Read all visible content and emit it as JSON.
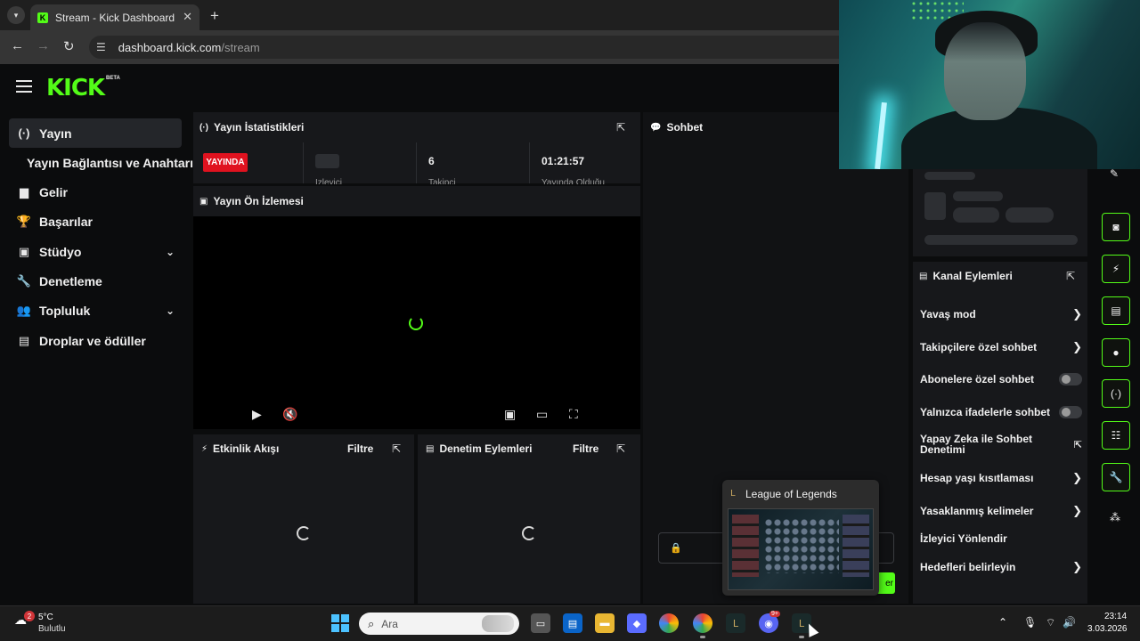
{
  "browser": {
    "tab_title": "Stream - Kick Dashboard",
    "tab_favicon": "K",
    "url_host": "dashboard.kick.com",
    "url_path": "/stream"
  },
  "header": {
    "logo_text": "KICK",
    "beta_label": "BETA"
  },
  "sidebar": {
    "items": [
      {
        "label": "Yayın",
        "icon": "broadcast-icon",
        "glyph": "(·)"
      },
      {
        "label": "Yayın Bağlantısı ve Anahtarı",
        "icon": "",
        "glyph": ""
      },
      {
        "label": "Gelir",
        "icon": "chart-icon",
        "glyph": "▆"
      },
      {
        "label": "Başarılar",
        "icon": "trophy-icon",
        "glyph": "🏆"
      },
      {
        "label": "Stüdyo",
        "icon": "studio-icon",
        "glyph": "▣",
        "chevron": "⌄"
      },
      {
        "label": "Denetleme",
        "icon": "wrench-icon",
        "glyph": "🔧"
      },
      {
        "label": "Topluluk",
        "icon": "people-icon",
        "glyph": "👥",
        "chevron": "⌄"
      },
      {
        "label": "Droplar ve ödüller",
        "icon": "gift-icon",
        "glyph": "▤"
      }
    ]
  },
  "stats_panel": {
    "title": "Yayın İstatistikleri",
    "live_badge": "YAYINDA",
    "viewers_label": "İzleyici",
    "followers_value": "6",
    "followers_label": "Takipçi",
    "duration_value": "01:21:57",
    "duration_label": "Yayında Olduğu"
  },
  "preview_panel": {
    "title": "Yayın Ön İzlemesi"
  },
  "events_panel": {
    "title": "Etkinlik Akışı",
    "filter_label": "Filtre"
  },
  "mod_panel": {
    "title": "Denetim Eylemleri",
    "filter_label": "Filtre"
  },
  "chat_panel": {
    "title": "Sohbet",
    "send_label": "er"
  },
  "actions_panel": {
    "title": "Kanal Eylemleri",
    "rows": [
      {
        "label": "Yavaş mod",
        "control": "chevron"
      },
      {
        "label": "Takipçilere özel sohbet",
        "control": "chevron"
      },
      {
        "label": "Abonelere özel sohbet",
        "control": "toggle",
        "enabled": false
      },
      {
        "label": "Yalnızca ifadelerle sohbet",
        "control": "toggle",
        "enabled": false
      },
      {
        "label": "Yapay Zeka ile Sohbet Denetimi",
        "control": "external"
      },
      {
        "label": "Hesap yaşı kısıtlaması",
        "control": "chevron"
      },
      {
        "label": "Yasaklanmış kelimeler",
        "control": "chevron"
      },
      {
        "label": "İzleyici Yönlendir",
        "control": "none"
      },
      {
        "label": "Hedefleri belirleyin",
        "control": "chevron"
      }
    ]
  },
  "rail": {
    "buttons": [
      "preview-icon",
      "lightning-icon",
      "notes-icon",
      "chat-icon",
      "broadcast-icon",
      "layout-icon",
      "wrench-icon"
    ]
  },
  "popup": {
    "title": "League of Legends"
  },
  "taskbar": {
    "weather_temp": "5°C",
    "weather_desc": "Bulutlu",
    "weather_badge": "2",
    "search_placeholder": "Ara",
    "discord_badge": "9+",
    "clock_time": "23:14",
    "clock_date": "3.03.2026"
  },
  "colors": {
    "accent": "#53fc18",
    "live": "#e0121f",
    "background": "#0b0c0d",
    "panel": "#17181b"
  }
}
